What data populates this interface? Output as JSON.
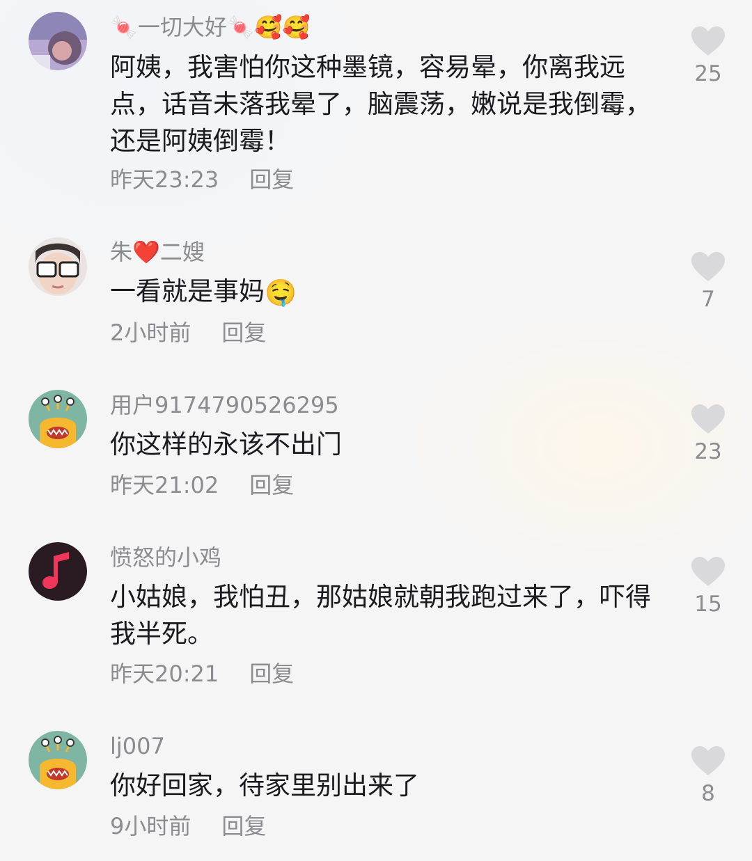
{
  "comments": [
    {
      "username_pre": "🍬",
      "username": "一切大好",
      "username_post": "🍬🥰🥰",
      "text": "阿姨，我害怕你这种墨镜，容易晕，你离我远点，话音未落我晕了，脑震荡，嫩说是我倒霉，还是阿姨倒霉！",
      "time": "昨天23:23",
      "reply_label": "回复",
      "likes": "25",
      "avatar": "photo-baby-avatar"
    },
    {
      "username_pre": "朱",
      "username_heart": "❤️",
      "username": "二嫂",
      "text": "一看就是事妈",
      "text_emoji": "🤤",
      "time": "2小时前",
      "reply_label": "回复",
      "likes": "7",
      "avatar": "photo-sunglasses-avatar"
    },
    {
      "username": "用户9174790526295",
      "text": "你这样的永该不出门",
      "time": "昨天21:02",
      "reply_label": "回复",
      "likes": "23",
      "avatar": "monster-default-avatar"
    },
    {
      "username": "愤怒的小鸡",
      "text": "小姑娘，我怕丑，那姑娘就朝我跑过来了，吓得我半死。",
      "time": "昨天20:21",
      "reply_label": "回复",
      "likes": "15",
      "avatar": "music-note-avatar"
    },
    {
      "username": "lj007",
      "text": "你好回家，待家里别出来了",
      "time": "9小时前",
      "reply_label": "回复",
      "likes": "8",
      "avatar": "monster-default-avatar"
    }
  ],
  "colors": {
    "text": "#1b1b1f",
    "secondary": "#8c8c90",
    "heart": "#d9d9dc",
    "monster_bg": "#7fb5a3",
    "monster_body": "#f5b82e",
    "music_bg": "#2a1a22",
    "music_note": "#f0365a"
  }
}
